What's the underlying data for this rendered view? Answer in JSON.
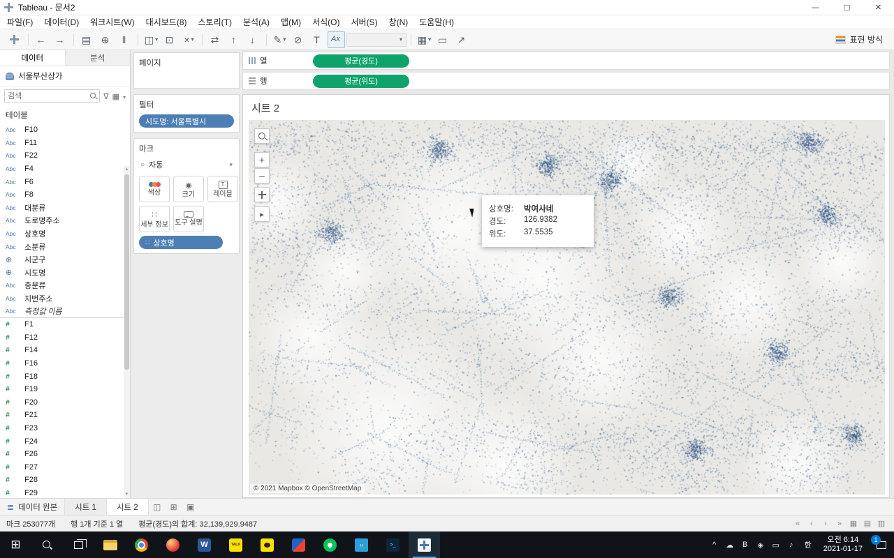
{
  "window": {
    "title": "Tableau - 문서2"
  },
  "menu": {
    "items": [
      "파일(F)",
      "데이터(D)",
      "워크시트(W)",
      "대시보드(8)",
      "스토리(T)",
      "분석(A)",
      "맵(M)",
      "서식(O)",
      "서버(S)",
      "창(N)",
      "도움말(H)"
    ]
  },
  "toolbar": {
    "show_me_label": "표현 방식",
    "items": [
      {
        "name": "tableau-logo-icon",
        "cls": "logo",
        "glyph": ""
      },
      {
        "name": "toolbar-separator",
        "cls": "sep"
      },
      {
        "name": "undo-icon",
        "glyph": "←"
      },
      {
        "name": "redo-icon",
        "glyph": "→"
      },
      {
        "name": "toolbar-separator",
        "cls": "sep"
      },
      {
        "name": "save-icon",
        "glyph": "▤"
      },
      {
        "name": "add-datasource-icon",
        "glyph": "⊕"
      },
      {
        "name": "pause-updates-icon",
        "glyph": "‖"
      },
      {
        "name": "toolbar-separator",
        "cls": "sep"
      },
      {
        "name": "new-worksheet-icon",
        "glyph": "◫",
        "caret": "▾"
      },
      {
        "name": "duplicate-icon",
        "glyph": "⊡"
      },
      {
        "name": "clear-sheet-icon",
        "glyph": "×",
        "caret": "▾"
      },
      {
        "name": "toolbar-separator",
        "cls": "sep"
      },
      {
        "name": "swap-axes-icon",
        "glyph": "⇄"
      },
      {
        "name": "sort-ascending-icon",
        "glyph": "↑"
      },
      {
        "name": "sort-descending-icon",
        "glyph": "↓"
      },
      {
        "name": "toolbar-separator",
        "cls": "sep"
      },
      {
        "name": "highlight-icon",
        "glyph": "✎",
        "caret": "▾"
      },
      {
        "name": "group-members-icon",
        "glyph": "⊘"
      },
      {
        "name": "show-mark-labels-icon",
        "glyph": "T"
      },
      {
        "name": "fix-axes-icon",
        "cls": "active-tool",
        "glyph": "Ax"
      },
      {
        "name": "fit-selector",
        "cls": "combo",
        "glyph": "",
        "caret": "▾"
      },
      {
        "name": "toolbar-separator",
        "cls": "sep"
      },
      {
        "name": "fit-view-icon",
        "glyph": "▦",
        "caret": "▾"
      },
      {
        "name": "presentation-mode-icon",
        "glyph": "▭"
      },
      {
        "name": "share-icon",
        "glyph": "↗"
      }
    ]
  },
  "sidebar": {
    "tabs": {
      "data": "데이터",
      "analytics": "분석"
    },
    "datasource": "서울부산상가",
    "search_placeholder": "검색",
    "section_title": "테이블",
    "fields": [
      {
        "t": "text",
        "label": "F10"
      },
      {
        "t": "text",
        "label": "F11"
      },
      {
        "t": "text",
        "label": "F22"
      },
      {
        "t": "text",
        "label": "F4"
      },
      {
        "t": "text",
        "label": "F6"
      },
      {
        "t": "text",
        "label": "F8"
      },
      {
        "t": "text",
        "label": "대분류"
      },
      {
        "t": "text",
        "label": "도로명주소"
      },
      {
        "t": "text",
        "label": "상호명"
      },
      {
        "t": "text",
        "label": "소분류"
      },
      {
        "t": "geo",
        "label": "시군구"
      },
      {
        "t": "geo",
        "label": "시도명"
      },
      {
        "t": "text",
        "label": "중분류"
      },
      {
        "t": "text",
        "label": "지번주소"
      },
      {
        "t": "text",
        "label": "측정값 이름",
        "cls": "italic divider"
      },
      {
        "t": "num",
        "label": "F1"
      },
      {
        "t": "num",
        "label": "F12"
      },
      {
        "t": "num",
        "label": "F14"
      },
      {
        "t": "num",
        "label": "F16"
      },
      {
        "t": "num",
        "label": "F18"
      },
      {
        "t": "num",
        "label": "F19"
      },
      {
        "t": "num",
        "label": "F20"
      },
      {
        "t": "num",
        "label": "F21"
      },
      {
        "t": "num",
        "label": "F23"
      },
      {
        "t": "num",
        "label": "F24"
      },
      {
        "t": "num",
        "label": "F26"
      },
      {
        "t": "num",
        "label": "F27"
      },
      {
        "t": "num",
        "label": "F28"
      },
      {
        "t": "num",
        "label": "F29"
      }
    ]
  },
  "cards": {
    "pages_title": "페이지",
    "filters_title": "필터",
    "filter_pill": "시도명: 서울특별시",
    "marks_title": "마크",
    "mark_type": "자동",
    "buttons": [
      {
        "label": "색상"
      },
      {
        "label": "크기"
      },
      {
        "label": "레이블"
      },
      {
        "label": "세부 정보"
      },
      {
        "label": "도구 설명"
      }
    ],
    "detail_pill": "상호명"
  },
  "shelves": {
    "columns_label": "열",
    "rows_label": "행",
    "columns_pill": "평균(경도)",
    "rows_pill": "평균(위도)"
  },
  "sheet": {
    "title": "시트 2",
    "attribution": "© 2021 Mapbox © OpenStreetMap",
    "tooltip": {
      "rows": [
        {
          "label": "상호명:",
          "value": "박여사네",
          "cls": "bold"
        },
        {
          "label": "경도:",
          "value": "126.9382"
        },
        {
          "label": "위도:",
          "value": "37.5535"
        }
      ]
    }
  },
  "chart_data": {
    "type": "scatter",
    "subtype": "map",
    "title": "시트 2",
    "mark_type": "자동",
    "mark_count": 253077,
    "x_field": "평균(경도)",
    "y_field": "평균(위도)",
    "detail_field": "상호명",
    "filters": [
      "시도명: 서울특별시"
    ],
    "visible_tooltip_point": {
      "상호명": "박여사네",
      "경도": 126.9382,
      "위도": 37.5535
    },
    "basemap_attribution": "© 2021 Mapbox © OpenStreetMap",
    "dot_color": "#3e689c"
  },
  "bottom_tabs": {
    "datasource_tab": "데이터 원본",
    "sheet1": "시트 1",
    "sheet2": "시트 2"
  },
  "status_bar": {
    "marks": "마크 253077개",
    "selection": "행 1개 기준 1 열",
    "aggregate": "평균(경도)의 합계: 32,139,929.9487",
    "nav_icons": [
      {
        "name": "first-sheet-icon",
        "glyph": "«"
      },
      {
        "name": "prev-sheet-icon",
        "glyph": "‹"
      },
      {
        "name": "next-sheet-icon",
        "glyph": "›"
      },
      {
        "name": "last-sheet-icon",
        "glyph": "»"
      },
      {
        "name": "show-sheet-tabs-icon",
        "glyph": "▦"
      },
      {
        "name": "show-filmstrip-icon",
        "glyph": "▤"
      },
      {
        "name": "show-sheet-sorter-icon",
        "glyph": "▥"
      }
    ]
  },
  "taskbar": {
    "apps": [
      {
        "name": "file-explorer-icon",
        "cls": "file-explorer"
      },
      {
        "name": "chrome-icon",
        "cls": "chrome"
      },
      {
        "name": "browser-icon",
        "cls": "browser"
      },
      {
        "name": "word-icon",
        "cls": "word"
      },
      {
        "name": "kakaotalk-icon",
        "cls": "kakaotalk"
      },
      {
        "name": "kakao-icon",
        "cls": "kakao"
      },
      {
        "name": "hancom-icon",
        "cls": "hancom"
      },
      {
        "name": "map-app-icon",
        "cls": "kakaomap"
      },
      {
        "name": "vscode-icon",
        "cls": "vscode"
      },
      {
        "name": "terminal-icon",
        "cls": "terminal"
      },
      {
        "name": "tableau-icon",
        "cls": "tableau active"
      }
    ],
    "tray": [
      {
        "name": "hidden-icons-icon",
        "glyph": "^"
      },
      {
        "name": "cloud-icon",
        "glyph": "☁"
      },
      {
        "name": "bluetooth-icon",
        "glyph": "Ƀ"
      },
      {
        "name": "security-icon",
        "glyph": "◈"
      },
      {
        "name": "display-icon",
        "glyph": "▭"
      },
      {
        "name": "volume-icon",
        "glyph": "♪"
      }
    ],
    "lang": "한",
    "time": "오전 6:14",
    "date": "2021-01-17",
    "badge": "1"
  },
  "colors": {
    "pill_blue": "#4d7fb5",
    "pill_green": "#0ea36b",
    "dot_blue": "#3e689c",
    "field_icon_blue": "#4e79a7",
    "measure_icon_green": "#2f8e57",
    "taskbar_bg": "#101419",
    "badge_blue": "#0078d7"
  }
}
